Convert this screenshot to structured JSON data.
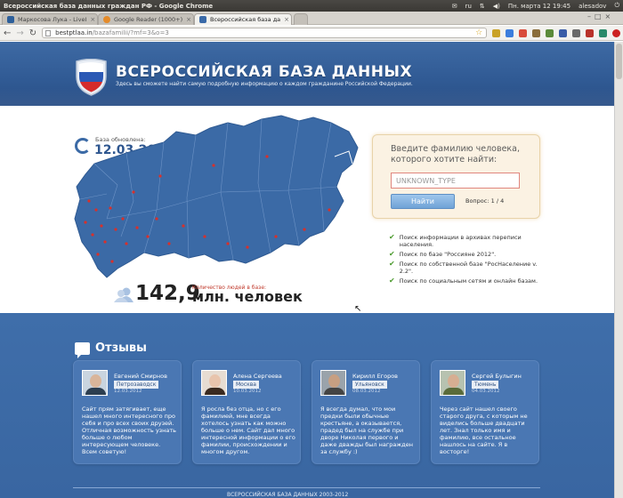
{
  "system": {
    "window_title": "Всероссийская база данных граждан РФ - Google Chrome",
    "keyboard_layout": "ru",
    "datetime": "Пн. марта 12 19:45",
    "user": "alesadov"
  },
  "tabs": [
    {
      "label": "Маркосова Лука - LiveI",
      "favicon_color": "#2d5f9a"
    },
    {
      "label": "Google Reader (1000+)",
      "favicon_color": "#e48b2a"
    },
    {
      "label": "Всероссийская база да",
      "favicon_color": "#3a6aa8",
      "active": true
    }
  ],
  "address_bar": {
    "host": "bestptlaa.in",
    "path": "/bazafamilii/?mf=3&o=3"
  },
  "site": {
    "title": "ВСЕРОССИЙСКАЯ БАЗА ДАННЫХ",
    "subtitle": "Здесь вы сможете найти самую подробную информацию о каждом гражданине Российской Федерации."
  },
  "update": {
    "label": "База обновлена:",
    "date": "12.03.2012"
  },
  "count": {
    "label": "Количество людей в базе:",
    "number": "142,9",
    "unit": "млн. человек"
  },
  "search": {
    "prompt": "Введите фамилию человека, которого хотите найти:",
    "input_value": "UNKNOWN_TYPE",
    "button_label": "Найти",
    "question": "Вопрос: 1 / 4"
  },
  "features": [
    "Поиск информации в архивах переписи населения.",
    "Поиск по базе \"Россияне 2012\".",
    "Поиск по собственной базе \"РосНаселение v. 2.2\".",
    "Поиск по социальным сетям и онлайн базам."
  ],
  "reviews": {
    "title": "Отзывы",
    "items": [
      {
        "name": "Евгений Смирнов",
        "city": "Петрозаводск",
        "date": "12.03.2012",
        "text": "Сайт прям затягивает, еще нашел много интересного про себя и про всех своих друзей. Отличная возможность узнать больше о любом интересующем человеке. Всем советую!",
        "skin": "#d9b59a",
        "shirt": "#2c3e50"
      },
      {
        "name": "Алена Сергеева",
        "city": "Москва",
        "date": "10.03.2012",
        "text": "Я росла без отца, но с его фамилией, мне всегда хотелось узнать как можно больше о нем. Сайт дал много интересной информации о его фамилии, происхождении и многом другом.",
        "skin": "#e8c4ad",
        "shirt": "#3a2a20"
      },
      {
        "name": "Кирилл Егоров",
        "city": "Ульяновск",
        "date": "08.03.2012",
        "text": "Я всегда думал, что мои предки были обычные крестьяне, а оказывается, прадед был на службе при дворе Николая первого и даже дважды был награжден за службу :)",
        "skin": "#c79f82",
        "shirt": "#444444"
      },
      {
        "name": "Сергей Булыгин",
        "city": "Тюмень",
        "date": "04.03.2012",
        "text": "Через сайт нашел своего старого друга, с которым не виделись больше двадцати лет. Знал только имя и фамилию, все остальное нашлось на сайте. Я в восторге!",
        "skin": "#d6ae92",
        "shirt": "#5a6b3a"
      }
    ]
  },
  "footer": {
    "text": "ВСЕРОССИЙСКАЯ БАЗА ДАННЫХ 2003-2012"
  },
  "colors": {
    "brand_blue": "#305a94",
    "map_blue": "#3b6aa6",
    "accent_red": "#c0392b"
  }
}
